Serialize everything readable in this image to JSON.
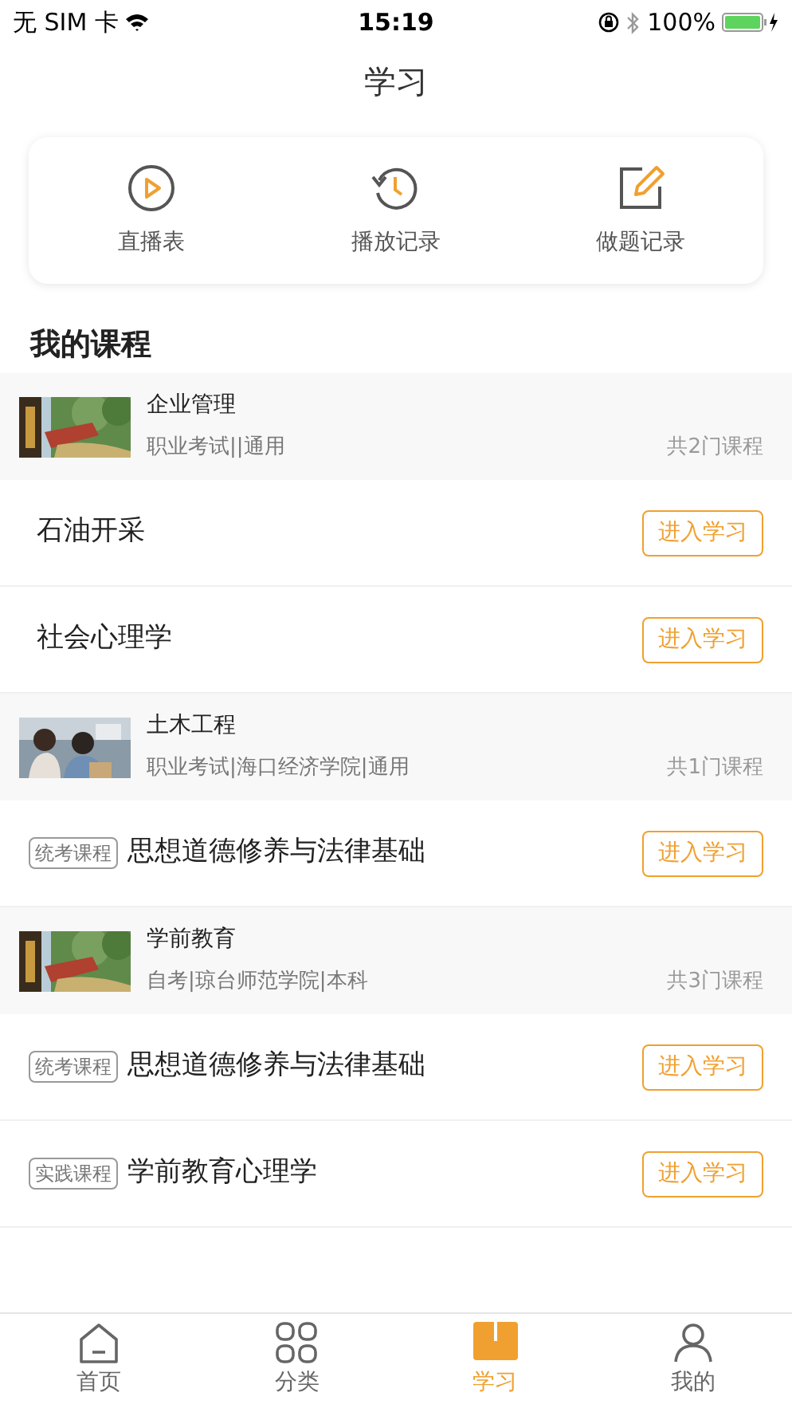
{
  "status_bar": {
    "carrier": "无 SIM 卡",
    "time": "15:19",
    "battery": "100%"
  },
  "title": "学习",
  "shortcuts": [
    {
      "kind": "play",
      "label": "直播表"
    },
    {
      "kind": "history",
      "label": "播放记录"
    },
    {
      "kind": "edit",
      "label": "做题记录"
    }
  ],
  "section_title": "我的课程",
  "items": [
    {
      "kind": "group",
      "title": "企业管理",
      "meta": "职业考试||通用",
      "count": "共2门课程"
    },
    {
      "kind": "course",
      "title": "石油开采",
      "button": "进入学习"
    },
    {
      "kind": "course",
      "title": "社会心理学",
      "button": "进入学习"
    },
    {
      "kind": "group",
      "title": "土木工程",
      "meta": "职业考试|海口经济学院|通用",
      "count": "共1门课程"
    },
    {
      "kind": "course",
      "tag": "统考课程",
      "title": "思想道德修养与法律基础",
      "button": "进入学习"
    },
    {
      "kind": "group",
      "title": "学前教育",
      "meta": "自考|琼台师范学院|本科",
      "count": "共3门课程"
    },
    {
      "kind": "course",
      "tag": "统考课程",
      "title": "思想道德修养与法律基础",
      "button": "进入学习"
    },
    {
      "kind": "course",
      "tag": "实践课程",
      "title": "学前教育心理学",
      "button": "进入学习"
    }
  ],
  "tab_bar": [
    {
      "kind": "home",
      "label": "首页",
      "selected": false
    },
    {
      "kind": "grid",
      "label": "分类",
      "selected": false
    },
    {
      "kind": "book",
      "label": "学习",
      "selected": true
    },
    {
      "kind": "person",
      "label": "我的",
      "selected": false
    }
  ]
}
